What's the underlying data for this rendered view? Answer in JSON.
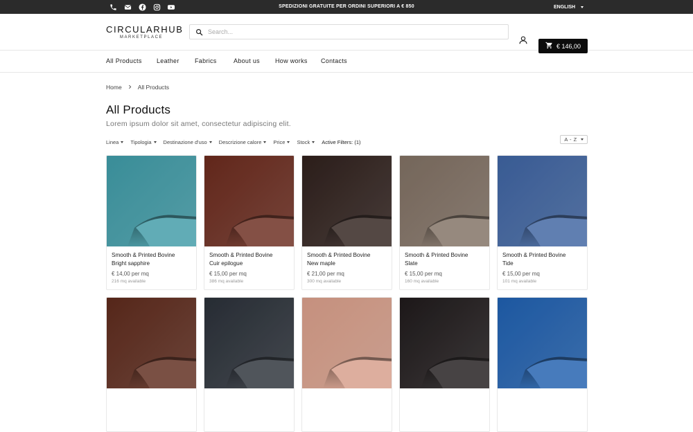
{
  "topbar": {
    "social_icons": [
      "phone-icon",
      "mail-icon",
      "facebook-icon",
      "instagram-icon",
      "youtube-icon"
    ],
    "promo": "SPEDIZIONI GRATUITE PER ORDINI SUPERIORI A € 850",
    "language": "ENGLISH"
  },
  "header": {
    "logo_main": "CIRCULARHUB",
    "logo_sub": "MARKETPLACE",
    "search_placeholder": "Search...",
    "cart_total": "€ 146,00"
  },
  "nav": [
    "All Products",
    "Leather",
    "Fabrics",
    "About us",
    "How works",
    "Contacts"
  ],
  "breadcrumb": [
    "Home",
    "All Products"
  ],
  "page": {
    "title": "All Products",
    "subtitle": "Lorem ipsum dolor sit amet, consectetur adipiscing elit."
  },
  "filters": [
    "Linea",
    "Tipologia",
    "Destinazione d'uso",
    "Descrizione calore",
    "Price",
    "Stock"
  ],
  "active_filters": "Active Filters: (1)",
  "sort": "A - Z",
  "colors": {
    "topbar_bg": "#2b2b2b",
    "cart_bg": "#0c0c0c"
  },
  "products": [
    {
      "line1": "Smooth & Printed Bovine",
      "line2": "Bright sapphire",
      "price": "€ 14,00 per mq",
      "availability": "216 mq available",
      "color": "#3f9aa6"
    },
    {
      "line1": "Smooth & Printed Bovine",
      "line2": "Cuir epilogue",
      "price": "€ 15,00 per mq",
      "availability": "386 mq available",
      "color": "#6a2a1d"
    },
    {
      "line1": "Smooth & Printed Bovine",
      "line2": "New maple",
      "price": "€ 21,00 per mq",
      "availability": "300 mq available",
      "color": "#2f201c"
    },
    {
      "line1": "Smooth & Printed Bovine",
      "line2": "Slate",
      "price": "€ 15,00 per mq",
      "availability": "160 mq available",
      "color": "#7f6f62"
    },
    {
      "line1": "Smooth & Printed Bovine",
      "line2": "Tide",
      "price": "€ 15,00 per mq",
      "availability": "101 mq available",
      "color": "#3e63a0"
    },
    {
      "color": "#5d2a1c"
    },
    {
      "color": "#2a3038"
    },
    {
      "color": "#d69d89"
    },
    {
      "color": "#1f1a1b"
    },
    {
      "color": "#1f5fae"
    }
  ]
}
